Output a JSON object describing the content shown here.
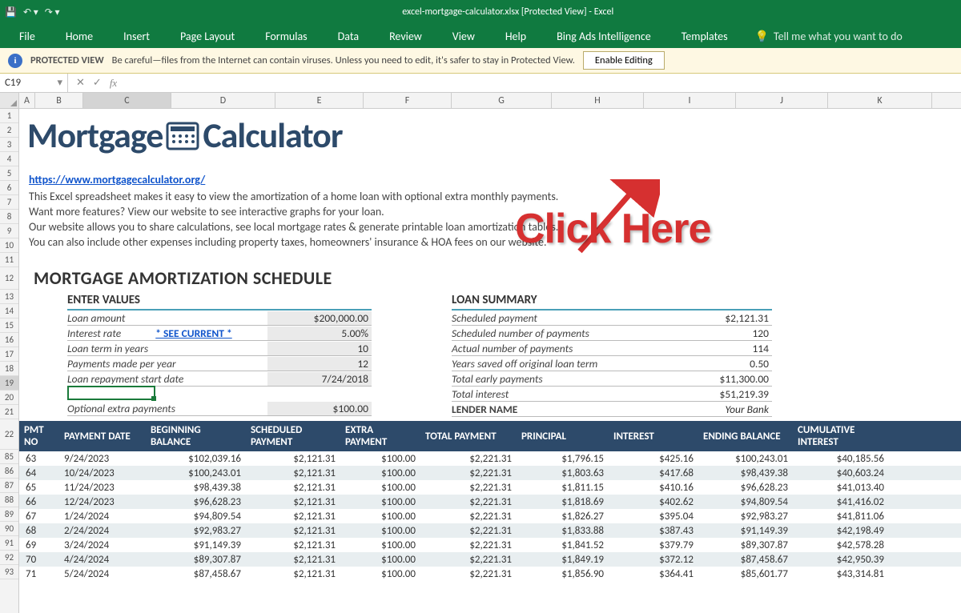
{
  "title": "excel-mortgage-calculator.xlsx  [Protected View]  -  Excel",
  "ribbon": [
    "File",
    "Home",
    "Insert",
    "Page Layout",
    "Formulas",
    "Data",
    "Review",
    "View",
    "Help",
    "Bing Ads Intelligence",
    "Templates"
  ],
  "tellme": "Tell me what you want to do",
  "protected": {
    "label": "PROTECTED VIEW",
    "msg": "Be careful—files from the Internet can contain viruses. Unless you need to edit, it's safer to stay in Protected View.",
    "btn": "Enable Editing"
  },
  "namebox": "C19",
  "cols": [
    "A",
    "B",
    "C",
    "D",
    "E",
    "F",
    "G",
    "H",
    "I",
    "J",
    "K"
  ],
  "rows_top": [
    "1",
    "2",
    "3",
    "4",
    "5",
    "6",
    "7",
    "8",
    "9",
    "10",
    "11"
  ],
  "row_12": "12",
  "rows_mid": [
    "13",
    "14",
    "15",
    "16",
    "17",
    "18",
    "19",
    "20",
    "21"
  ],
  "row_22": "22",
  "rows_bot": [
    "85",
    "86",
    "87",
    "88",
    "89",
    "90",
    "91",
    "92",
    "93"
  ],
  "logo1": "Mortgage",
  "logo2": "Calculator",
  "url": "https://www.mortgagecalculator.org/",
  "intro": [
    "This Excel spreadsheet makes it easy to view the amortization of a home loan with optional extra monthly payments.",
    "Want more features? View our website to see interactive graphs for your loan.",
    "Our website allows you to share calculations, see local mortgage rates & generate printable loan amortization tables.",
    "You can also include other expenses including property taxes, homeowners' insurance & HOA fees on our website."
  ],
  "section": "MORTGAGE AMORTIZATION SCHEDULE",
  "ev_hdr": "ENTER VALUES",
  "ev_rows": [
    {
      "l": "Loan amount",
      "v": "$200,000.00",
      "shade": true
    },
    {
      "l": "Interest rate",
      "v": "5.00%",
      "shade": true,
      "see": "* SEE CURRENT *"
    },
    {
      "l": "Loan term in years",
      "v": "10",
      "shade": true
    },
    {
      "l": "Payments made per year",
      "v": "12",
      "shade": true
    },
    {
      "l": "Loan repayment start date",
      "v": "7/24/2018",
      "shade": true
    }
  ],
  "ev_opt": {
    "l": "Optional extra payments",
    "v": "$100.00"
  },
  "ls_hdr": "LOAN SUMMARY",
  "ls_rows": [
    {
      "l": "Scheduled payment",
      "v": "$2,121.31"
    },
    {
      "l": "Scheduled number of payments",
      "v": "120"
    },
    {
      "l": "Actual number of payments",
      "v": "114"
    },
    {
      "l": "Years saved off original loan term",
      "v": "0.50"
    },
    {
      "l": "Total early payments",
      "v": "$11,300.00"
    },
    {
      "l": "Total interest",
      "v": "$51,219.39"
    }
  ],
  "lender": {
    "l": "LENDER NAME",
    "v": "Your Bank"
  },
  "thead": [
    "PMT NO",
    "PAYMENT DATE",
    "BEGINNING BALANCE",
    "SCHEDULED PAYMENT",
    "EXTRA PAYMENT",
    "TOTAL PAYMENT",
    "PRINCIPAL",
    "INTEREST",
    "ENDING BALANCE",
    "CUMULATIVE INTEREST"
  ],
  "trows": [
    [
      "63",
      "9/24/2023",
      "$102,039.16",
      "$2,121.31",
      "$100.00",
      "$2,221.31",
      "$1,796.15",
      "$425.16",
      "$100,243.01",
      "$40,185.56"
    ],
    [
      "64",
      "10/24/2023",
      "$100,243.01",
      "$2,121.31",
      "$100.00",
      "$2,221.31",
      "$1,803.63",
      "$417.68",
      "$98,439.38",
      "$40,603.24"
    ],
    [
      "65",
      "11/24/2023",
      "$98,439.38",
      "$2,121.31",
      "$100.00",
      "$2,221.31",
      "$1,811.15",
      "$410.16",
      "$96,628.23",
      "$41,013.40"
    ],
    [
      "66",
      "12/24/2023",
      "$96,628.23",
      "$2,121.31",
      "$100.00",
      "$2,221.31",
      "$1,818.69",
      "$402.62",
      "$94,809.54",
      "$41,416.02"
    ],
    [
      "67",
      "1/24/2024",
      "$94,809.54",
      "$2,121.31",
      "$100.00",
      "$2,221.31",
      "$1,826.27",
      "$395.04",
      "$92,983.27",
      "$41,811.06"
    ],
    [
      "68",
      "2/24/2024",
      "$92,983.27",
      "$2,121.31",
      "$100.00",
      "$2,221.31",
      "$1,833.88",
      "$387.43",
      "$91,149.39",
      "$42,198.49"
    ],
    [
      "69",
      "3/24/2024",
      "$91,149.39",
      "$2,121.31",
      "$100.00",
      "$2,221.31",
      "$1,841.52",
      "$379.79",
      "$89,307.87",
      "$42,578.28"
    ],
    [
      "70",
      "4/24/2024",
      "$89,307.87",
      "$2,121.31",
      "$100.00",
      "$2,221.31",
      "$1,849.19",
      "$372.12",
      "$87,458.67",
      "$42,950.39"
    ],
    [
      "71",
      "5/24/2024",
      "$87,458.67",
      "$2,121.31",
      "$100.00",
      "$2,221.31",
      "$1,856.90",
      "$364.41",
      "$85,601.77",
      "$43,314.81"
    ]
  ],
  "anno": "Click Here"
}
